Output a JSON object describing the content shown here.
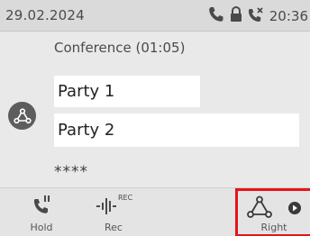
{
  "status_bar": {
    "date": "29.02.2024",
    "time": "20:36",
    "icons": [
      "phone-icon",
      "lock-icon",
      "missed-call-icon"
    ]
  },
  "call": {
    "title": "Conference (01:05)",
    "parties": [
      {
        "name": "Party 1"
      },
      {
        "name": "Party 2"
      }
    ],
    "masked_number": "****",
    "avatar_icon": "conference-icon"
  },
  "softkeys": [
    {
      "label": "Hold",
      "icon": "hold-icon"
    },
    {
      "label": "Rec",
      "icon": "record-icon",
      "icon_text": "REC"
    },
    {
      "label": "Right",
      "icon": "conference-icon",
      "selected": true
    }
  ],
  "colors": {
    "selection": "#e3141b",
    "background": "#e9e9e9",
    "status_bar": "#dadada"
  }
}
